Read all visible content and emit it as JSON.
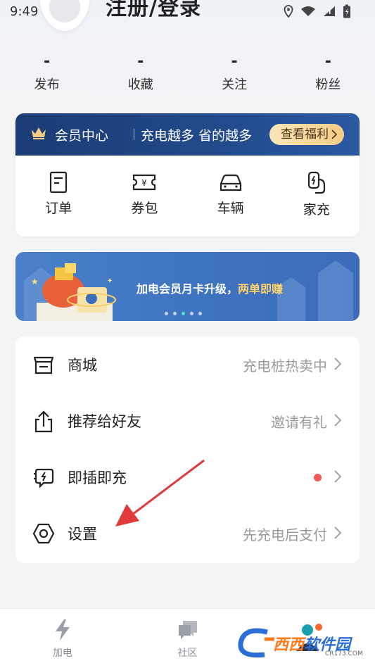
{
  "status_bar": {
    "time": "9:49"
  },
  "profile": {
    "login_text": "注册/登录"
  },
  "stats": [
    {
      "value": "-",
      "label": "发布"
    },
    {
      "value": "-",
      "label": "收藏"
    },
    {
      "value": "-",
      "label": "关注"
    },
    {
      "value": "-",
      "label": "粉丝"
    }
  ],
  "member": {
    "title": "会员中心",
    "subtitle": "充电越多 省的越多",
    "button": "查看福利",
    "quick_items": [
      {
        "label": "订单",
        "icon": "order-icon"
      },
      {
        "label": "券包",
        "icon": "coupon-icon"
      },
      {
        "label": "车辆",
        "icon": "car-icon"
      },
      {
        "label": "家充",
        "icon": "home-charger-icon"
      }
    ]
  },
  "banner": {
    "text": "加电会员月卡升级，",
    "highlight": "两单即赚",
    "dots": 5,
    "active_dot": 2
  },
  "menu": [
    {
      "label": "商城",
      "right": "充电桩热卖中",
      "icon": "store-icon"
    },
    {
      "label": "推荐给好友",
      "right": "邀请有礼",
      "icon": "share-icon"
    },
    {
      "label": "即插即充",
      "right": "",
      "icon": "plug-charge-icon"
    },
    {
      "label": "设置",
      "right": "先充电后支付",
      "icon": "settings-icon"
    }
  ],
  "bottom_nav": [
    {
      "label": "加电",
      "icon": "lightning-icon"
    },
    {
      "label": "社区",
      "icon": "chat-icon"
    },
    {
      "label": "",
      "icon": "mine-icon"
    }
  ],
  "watermark": {
    "text_a": "西西",
    "text_b": "软件园",
    "url": "CR173.COM"
  },
  "colors": {
    "accent_red": "#f15b57",
    "member_blue": "#1b3c74",
    "gold": "#f3cc86"
  }
}
